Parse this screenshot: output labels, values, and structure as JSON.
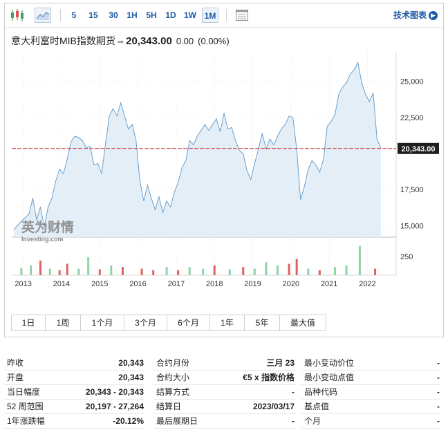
{
  "toolbar": {
    "timeframes": [
      "5",
      "15",
      "30",
      "1H",
      "5H",
      "1D",
      "1W",
      "1M"
    ],
    "active_timeframe": "1M",
    "tech_chart_link": "技术图表",
    "accent_color": "#1a5aa6"
  },
  "instrument": {
    "name": "意大利富时MIB指数期货",
    "price": "20,343.00",
    "change": "0.00",
    "change_pct": "(0.00%)"
  },
  "watermark": {
    "brand": "英为财情",
    "sub": "Investing.com"
  },
  "chart_data": {
    "type": "area",
    "title": "",
    "x_labels": [
      "2013",
      "2014",
      "2015",
      "2016",
      "2017",
      "2018",
      "2019",
      "2020",
      "2021",
      "2022"
    ],
    "xlim": [
      2012.7,
      2022.75
    ],
    "ylim": [
      14200,
      26800
    ],
    "y_ticks": [
      15000,
      17500,
      22500,
      25000
    ],
    "y_tick_labels": [
      "15,000",
      "17,500",
      "22,500",
      "25,000"
    ],
    "current_price": 20343,
    "current_price_label": "20,343.00",
    "line_color": "#6aa0cf",
    "fill_color": "#e4eef7",
    "reference_line_color": "#c1272d",
    "price_series": [
      [
        2012.75,
        14700
      ],
      [
        2012.95,
        15300
      ],
      [
        2013.15,
        15800
      ],
      [
        2013.25,
        16900
      ],
      [
        2013.35,
        15400
      ],
      [
        2013.45,
        16300
      ],
      [
        2013.55,
        14900
      ],
      [
        2013.65,
        16300
      ],
      [
        2013.75,
        16900
      ],
      [
        2013.85,
        18100
      ],
      [
        2013.95,
        18900
      ],
      [
        2014.05,
        18600
      ],
      [
        2014.15,
        19600
      ],
      [
        2014.25,
        20800
      ],
      [
        2014.35,
        21200
      ],
      [
        2014.45,
        21100
      ],
      [
        2014.55,
        20900
      ],
      [
        2014.65,
        20400
      ],
      [
        2014.75,
        20500
      ],
      [
        2014.85,
        19200
      ],
      [
        2014.95,
        19300
      ],
      [
        2015.05,
        18600
      ],
      [
        2015.15,
        20600
      ],
      [
        2015.25,
        22600
      ],
      [
        2015.35,
        23100
      ],
      [
        2015.45,
        22600
      ],
      [
        2015.55,
        23500
      ],
      [
        2015.65,
        22600
      ],
      [
        2015.75,
        21700
      ],
      [
        2015.85,
        22000
      ],
      [
        2015.95,
        20900
      ],
      [
        2016.05,
        18100
      ],
      [
        2016.15,
        16700
      ],
      [
        2016.25,
        17800
      ],
      [
        2016.35,
        16900
      ],
      [
        2016.45,
        16100
      ],
      [
        2016.55,
        17000
      ],
      [
        2016.65,
        15900
      ],
      [
        2016.75,
        16700
      ],
      [
        2016.85,
        16300
      ],
      [
        2016.95,
        17300
      ],
      [
        2017.05,
        18000
      ],
      [
        2017.15,
        19000
      ],
      [
        2017.25,
        19500
      ],
      [
        2017.35,
        20900
      ],
      [
        2017.45,
        20600
      ],
      [
        2017.55,
        21200
      ],
      [
        2017.65,
        21600
      ],
      [
        2017.75,
        22000
      ],
      [
        2017.85,
        21600
      ],
      [
        2017.95,
        22000
      ],
      [
        2018.05,
        22400
      ],
      [
        2018.15,
        21500
      ],
      [
        2018.25,
        22800
      ],
      [
        2018.35,
        21700
      ],
      [
        2018.45,
        21800
      ],
      [
        2018.55,
        20900
      ],
      [
        2018.65,
        20200
      ],
      [
        2018.75,
        20000
      ],
      [
        2018.85,
        18800
      ],
      [
        2018.95,
        18200
      ],
      [
        2019.05,
        19300
      ],
      [
        2019.15,
        20300
      ],
      [
        2019.25,
        21400
      ],
      [
        2019.35,
        20300
      ],
      [
        2019.45,
        21000
      ],
      [
        2019.55,
        20600
      ],
      [
        2019.65,
        21200
      ],
      [
        2019.75,
        21700
      ],
      [
        2019.85,
        22000
      ],
      [
        2019.95,
        22600
      ],
      [
        2020.05,
        22500
      ],
      [
        2020.15,
        20300
      ],
      [
        2020.25,
        16800
      ],
      [
        2020.35,
        17700
      ],
      [
        2020.45,
        18900
      ],
      [
        2020.55,
        19500
      ],
      [
        2020.65,
        19200
      ],
      [
        2020.75,
        18700
      ],
      [
        2020.85,
        19600
      ],
      [
        2020.95,
        21900
      ],
      [
        2021.05,
        22200
      ],
      [
        2021.15,
        22700
      ],
      [
        2021.25,
        24100
      ],
      [
        2021.35,
        24600
      ],
      [
        2021.45,
        24900
      ],
      [
        2021.55,
        25500
      ],
      [
        2021.65,
        25800
      ],
      [
        2021.75,
        26300
      ],
      [
        2021.85,
        24900
      ],
      [
        2021.95,
        24100
      ],
      [
        2022.05,
        23600
      ],
      [
        2022.15,
        24200
      ],
      [
        2022.25,
        21000
      ],
      [
        2022.35,
        20343
      ]
    ],
    "volume_series": [
      {
        "x": 2012.95,
        "v": 22,
        "dir": "up"
      },
      {
        "x": 2013.2,
        "v": 30,
        "dir": "up"
      },
      {
        "x": 2013.45,
        "v": 45,
        "dir": "down"
      },
      {
        "x": 2013.7,
        "v": 20,
        "dir": "up"
      },
      {
        "x": 2013.95,
        "v": 15,
        "dir": "down"
      },
      {
        "x": 2014.15,
        "v": 35,
        "dir": "down"
      },
      {
        "x": 2014.45,
        "v": 20,
        "dir": "up"
      },
      {
        "x": 2014.7,
        "v": 55,
        "dir": "up"
      },
      {
        "x": 2015.0,
        "v": 18,
        "dir": "down"
      },
      {
        "x": 2015.3,
        "v": 30,
        "dir": "up"
      },
      {
        "x": 2015.6,
        "v": 25,
        "dir": "down"
      },
      {
        "x": 2016.1,
        "v": 20,
        "dir": "down"
      },
      {
        "x": 2016.4,
        "v": 15,
        "dir": "down"
      },
      {
        "x": 2016.75,
        "v": 25,
        "dir": "up"
      },
      {
        "x": 2017.05,
        "v": 15,
        "dir": "down"
      },
      {
        "x": 2017.35,
        "v": 25,
        "dir": "up"
      },
      {
        "x": 2017.7,
        "v": 20,
        "dir": "up"
      },
      {
        "x": 2018.0,
        "v": 30,
        "dir": "down"
      },
      {
        "x": 2018.4,
        "v": 18,
        "dir": "up"
      },
      {
        "x": 2018.75,
        "v": 25,
        "dir": "down"
      },
      {
        "x": 2019.05,
        "v": 20,
        "dir": "up"
      },
      {
        "x": 2019.35,
        "v": 40,
        "dir": "up"
      },
      {
        "x": 2019.65,
        "v": 30,
        "dir": "up"
      },
      {
        "x": 2019.95,
        "v": 35,
        "dir": "down"
      },
      {
        "x": 2020.15,
        "v": 50,
        "dir": "down"
      },
      {
        "x": 2020.45,
        "v": 20,
        "dir": "up"
      },
      {
        "x": 2020.75,
        "v": 15,
        "dir": "down"
      },
      {
        "x": 2021.15,
        "v": 25,
        "dir": "up"
      },
      {
        "x": 2021.45,
        "v": 30,
        "dir": "up"
      },
      {
        "x": 2021.8,
        "v": 90,
        "dir": "up"
      },
      {
        "x": 2022.2,
        "v": 20,
        "dir": "down"
      }
    ],
    "volume_max": 100,
    "volume_tick_label": "250",
    "up_color": "#8fd3a8",
    "down_color": "#e06060"
  },
  "range_buttons": [
    "1日",
    "1周",
    "1个月",
    "3个月",
    "6个月",
    "1年",
    "5年",
    "最大值"
  ],
  "stats": {
    "col1": [
      {
        "label": "昨收",
        "value": "20,343"
      },
      {
        "label": "开盘",
        "value": "20,343"
      },
      {
        "label": "当日幅度",
        "value": "20,343 - 20,343"
      },
      {
        "label": "52 周范围",
        "value": "20,197 - 27,264"
      },
      {
        "label": "1年涨跌幅",
        "value": "-20.12%"
      }
    ],
    "col2": [
      {
        "label": "合约月份",
        "value": "三月 23"
      },
      {
        "label": "合约大小",
        "value": "€5 x 指数价格"
      },
      {
        "label": "结算方式",
        "value": "-"
      },
      {
        "label": "结算日",
        "value": "2023/03/17"
      },
      {
        "label": "最后展期日",
        "value": "-"
      }
    ],
    "col3": [
      {
        "label": "最小变动价位",
        "value": "-"
      },
      {
        "label": "最小变动点值",
        "value": "-"
      },
      {
        "label": "品种代码",
        "value": "-"
      },
      {
        "label": "基点值",
        "value": "-"
      },
      {
        "label": "个月",
        "value": "-"
      }
    ]
  }
}
